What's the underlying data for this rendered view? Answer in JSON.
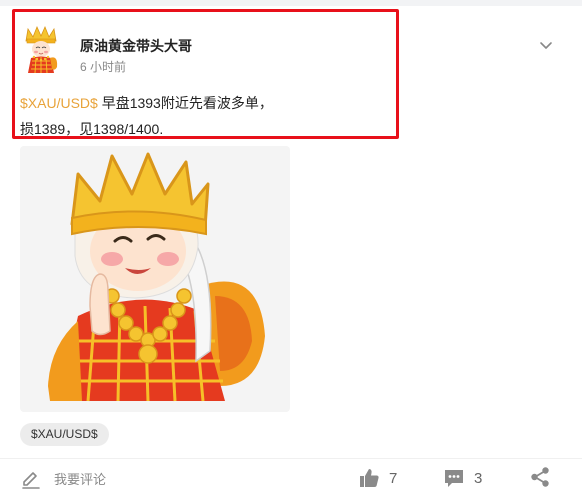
{
  "post": {
    "author": "原油黄金带头大哥",
    "time": "6 小时前",
    "ticker": "$XAU/USD$",
    "text_line1": " 早盘1393附近先看波多单，",
    "text_line2": "损1389，见1398/1400.",
    "avatar_icon": "monk-cartoon-avatar",
    "image_icon": "monk-cartoon-image"
  },
  "tag": {
    "label": "$XAU/USD$"
  },
  "actions": {
    "comment_label": "我要评论",
    "like_count": "7",
    "comment_count": "3"
  },
  "colors": {
    "highlight_border": "#e8101a",
    "ticker": "#e8a33a",
    "icon_gray": "#8a8a8a"
  }
}
